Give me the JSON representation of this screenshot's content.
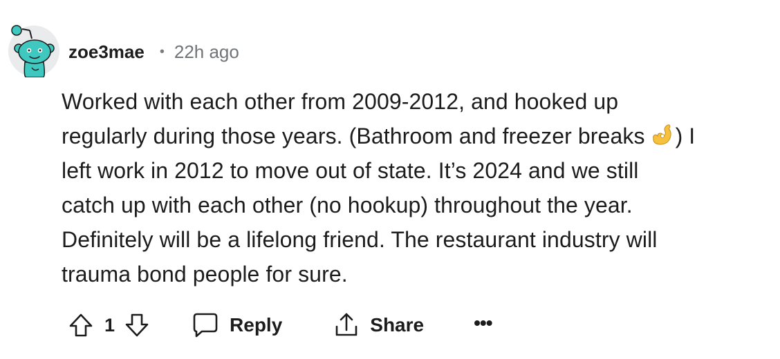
{
  "comment": {
    "author": "zoe3mae",
    "separator": "•",
    "timestamp": "22h ago",
    "body_lines": [
      "Worked with each other from 2009-2012, and hooked up",
      "regularly during those years. (Bathroom and freezer breaks",
      ") I",
      "left work in 2012 to move out of state. It’s 2024 and we still",
      "catch up with each other (no hookup) throughout the year.",
      "Definitely will be a lifelong friend. The restaurant industry will",
      "trauma bond people for sure."
    ],
    "inline_emoji": "ok-hand-emoji"
  },
  "actions": {
    "score": "1",
    "reply_label": "Reply",
    "share_label": "Share",
    "more_label": "•••"
  },
  "icons": {
    "avatar": "reddit-snoo-avatar",
    "upvote": "upvote-arrow-icon",
    "downvote": "downvote-arrow-icon",
    "reply": "speech-bubble-icon",
    "share": "share-upload-icon",
    "more": "ellipsis-icon"
  },
  "colors": {
    "avatar_background": "#e9ebed",
    "snoo_teal": "#3fc8c0",
    "text": "#1c1c1c",
    "meta": "#6f7477"
  }
}
